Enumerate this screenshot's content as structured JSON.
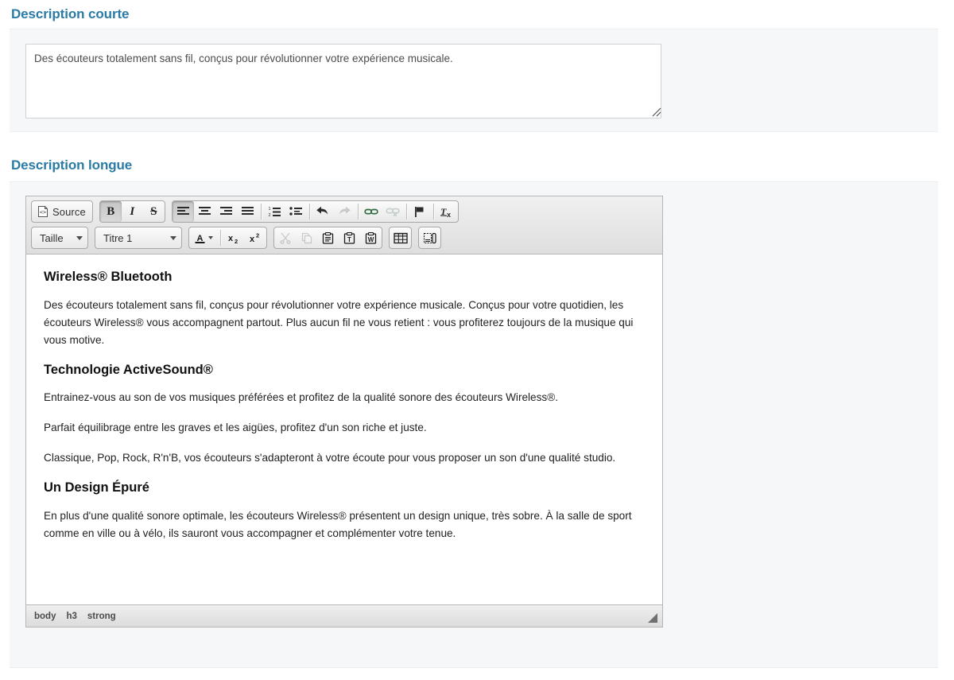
{
  "short_description": {
    "title": "Description courte",
    "textarea_value": "Des écouteurs totalement sans fil, conçus pour révolutionner votre expérience musicale.",
    "textarea_placeholder": ""
  },
  "long_description": {
    "title": "Description longue",
    "editor": {
      "toolbar_row1": {
        "source_label": "Source",
        "bold_glyph": "B",
        "italic_glyph": "I",
        "strike_glyph": "S"
      },
      "toolbar_row2": {
        "size_label": "Taille",
        "format_label": "Titre 1"
      },
      "element_path": [
        "body",
        "h3",
        "strong"
      ]
    },
    "content": [
      {
        "type": "h3",
        "text": "Wireless® Bluetooth"
      },
      {
        "type": "p",
        "text": "Des écouteurs totalement sans fil, conçus pour révolutionner votre expérience musicale. Conçus pour votre quotidien, les écouteurs Wireless® vous accompagnent partout. Plus aucun fil ne vous retient : vous profiterez toujours de la musique qui vous motive."
      },
      {
        "type": "h3",
        "text": "Technologie ActiveSound®"
      },
      {
        "type": "p",
        "text": "Entrainez-vous au son de vos musiques préférées et profitez de la qualité sonore des écouteurs Wireless®."
      },
      {
        "type": "p",
        "text": "Parfait équilibrage entre les graves et les aigües, profitez d'un son riche et juste."
      },
      {
        "type": "p",
        "text": "Classique, Pop, Rock, R'n'B, vos écouteurs s'adapteront à votre écoute pour vous proposer un son d'une qualité studio."
      },
      {
        "type": "h3",
        "text": "Un Design Épuré"
      },
      {
        "type": "p",
        "text": "En plus d'une qualité sonore optimale, les écouteurs Wireless® présentent un design unique, très sobre. À la salle de sport comme en ville ou à vélo, ils sauront vous accompagner et complémenter votre tenue."
      }
    ]
  },
  "colors": {
    "heading_blue": "#2a7ba5",
    "panel_bg": "#f6f7f9",
    "toolbar_bg": "#e4e4e4"
  }
}
